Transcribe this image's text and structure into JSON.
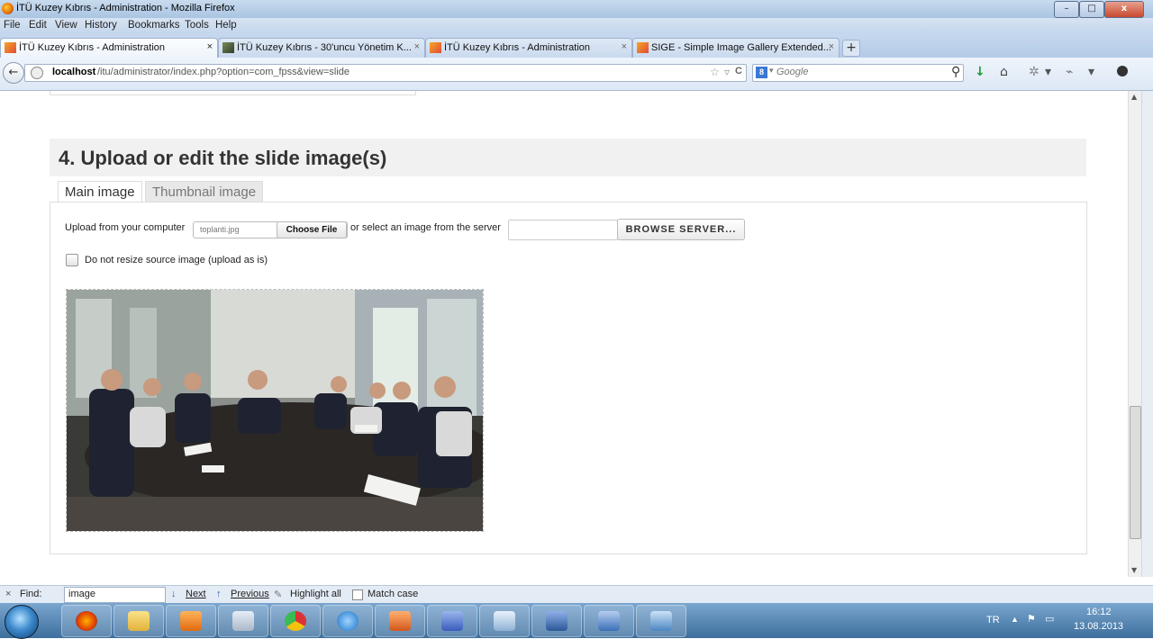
{
  "window": {
    "title": "İTÜ Kuzey Kıbrıs - Administration - Mozilla Firefox",
    "controls": [
      "–",
      "□",
      "x"
    ]
  },
  "menu": [
    "File",
    "Edit",
    "View",
    "History",
    "Bookmarks",
    "Tools",
    "Help"
  ],
  "tabs": [
    {
      "label": "İTÜ Kuzey Kıbrıs - Administration",
      "active": true
    },
    {
      "label": "İTÜ Kuzey Kıbrıs - 30'uncu Yönetim K...",
      "active": false
    },
    {
      "label": "İTÜ Kuzey Kıbrıs - Administration",
      "active": false
    },
    {
      "label": "SIGE - Simple Image Gallery Extended...",
      "active": false
    }
  ],
  "newtab_label": "+",
  "tab_close": "×",
  "nav": {
    "back": "←",
    "url_host": "localhost",
    "url_path": "/itu/administrator/index.php?option=com_fpss&view=slide",
    "search_badge": "8",
    "search_engine": "Google",
    "icons": {
      "star": "☆",
      "dropdown": "▿",
      "reload": "C",
      "search": "⚲",
      "download": "↓",
      "home": "⌂",
      "addon": "✲",
      "menu": "▾",
      "tools": "⌁"
    }
  },
  "page": {
    "section_title": "4. Upload or edit the slide image(s)",
    "image_tabs": [
      "Main image",
      "Thumbnail image"
    ],
    "upload_label": "Upload from your computer",
    "file_name": "toplanti.jpg",
    "choose_file": "Choose File",
    "server_label": "or select an image from the server",
    "server_value": "",
    "browse_button": "BROWSE SERVER...",
    "no_resize_label": "Do not resize source image (upload as is)",
    "no_resize_checked": false
  },
  "findbar": {
    "close": "×",
    "label": "Find:",
    "value": "image",
    "next": "Next",
    "previous": "Previous",
    "highlight": "Highlight all",
    "match_case": "Match case"
  },
  "taskbar": {
    "language": "TR",
    "time": "16:12",
    "date": "13.08.2013",
    "apps": [
      "firefox-icon",
      "folder-icon",
      "media-player-icon",
      "snipping-tool-icon",
      "chrome-icon",
      "ie-icon",
      "powerpoint-icon",
      "visio-icon",
      "paint-icon",
      "word-icon",
      "outlook-icon",
      "app-icon"
    ]
  },
  "colors": {
    "section_bg": "#f1f1f1",
    "heading": "#333333",
    "taskbar": "#3d6f9d"
  }
}
